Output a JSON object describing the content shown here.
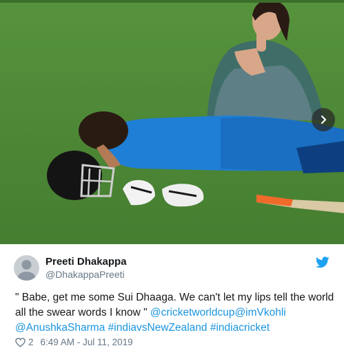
{
  "tweet": {
    "author_name": "Preeti Dhakappa",
    "author_handle": "@DhakappaPreeti",
    "text_parts": [
      "\" Babe, get me some Sui Dhaaga. We can't let my lips tell the world all the swear words I know \" ",
      "@cricketworldcup",
      "@imVkohli",
      " ",
      "@AnushkaSharma",
      " ",
      "#indiavsNewZealand",
      " ",
      "#indiacricket"
    ],
    "like_count": "2",
    "time": "6:49 AM - Jul 11, 2019"
  },
  "icons": {
    "next": "chevron-right-icon",
    "brand": "twitter-bird-icon",
    "like": "heart-icon",
    "avatar": "default-avatar-icon"
  },
  "colors": {
    "link": "#1b95e0",
    "twitter_blue": "#1da1f2",
    "grass": "#4f8a36",
    "jersey": "#1f7fd6"
  }
}
